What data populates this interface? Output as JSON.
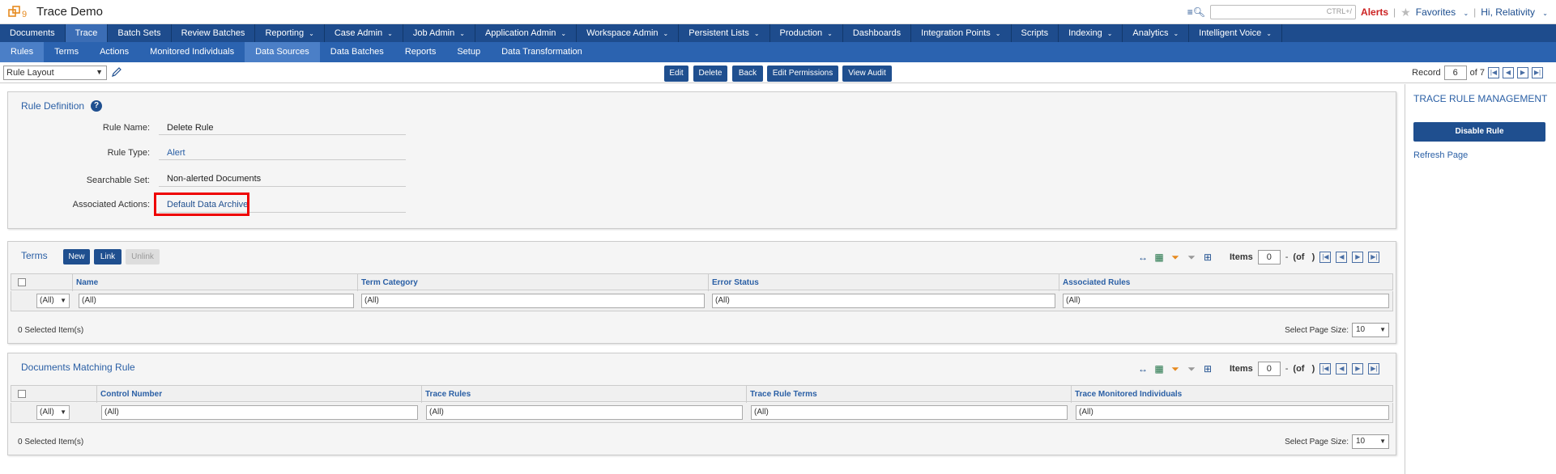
{
  "app": {
    "title": "Trace Demo"
  },
  "top": {
    "search_hint": "CTRL+/",
    "alerts": "Alerts",
    "favorites": "Favorites",
    "greeting": "Hi, Relativity"
  },
  "main_nav": [
    {
      "label": "Documents"
    },
    {
      "label": "Trace",
      "active": true
    },
    {
      "label": "Batch Sets"
    },
    {
      "label": "Review Batches"
    },
    {
      "label": "Reporting",
      "dropdown": true
    },
    {
      "label": "Case Admin",
      "dropdown": true
    },
    {
      "label": "Job Admin",
      "dropdown": true
    },
    {
      "label": "Application Admin",
      "dropdown": true
    },
    {
      "label": "Workspace Admin",
      "dropdown": true
    },
    {
      "label": "Persistent Lists",
      "dropdown": true
    },
    {
      "label": "Production",
      "dropdown": true
    },
    {
      "label": "Dashboards"
    },
    {
      "label": "Integration Points",
      "dropdown": true
    },
    {
      "label": "Scripts"
    },
    {
      "label": "Indexing",
      "dropdown": true
    },
    {
      "label": "Analytics",
      "dropdown": true
    },
    {
      "label": "Intelligent Voice",
      "dropdown": true
    }
  ],
  "sub_nav": [
    {
      "label": "Rules",
      "active": true
    },
    {
      "label": "Terms"
    },
    {
      "label": "Actions"
    },
    {
      "label": "Monitored Individuals"
    },
    {
      "label": "Data Sources",
      "active": true
    },
    {
      "label": "Data Batches"
    },
    {
      "label": "Reports"
    },
    {
      "label": "Setup"
    },
    {
      "label": "Data Transformation"
    }
  ],
  "toolbar": {
    "layout_value": "Rule Layout",
    "buttons": [
      "Edit",
      "Delete",
      "Back",
      "Edit Permissions",
      "View Audit"
    ],
    "record_label": "Record",
    "record_value": "6",
    "record_of": "of 7"
  },
  "rule_definition": {
    "title": "Rule Definition",
    "help": "?",
    "fields": [
      {
        "label": "Rule Name:",
        "value": "Delete Rule"
      },
      {
        "label": "Rule Type:",
        "value": "Alert"
      },
      {
        "label": "Searchable Set:",
        "value": "Non-alerted Documents"
      },
      {
        "label": "Associated Actions:",
        "value": "Default Data Archive"
      }
    ]
  },
  "sidebar": {
    "title": "Trace Rule Management",
    "button": "Disable Rule",
    "link": "Refresh Page"
  },
  "terms": {
    "title": "Terms",
    "buttons": {
      "new": "New",
      "link": "Link",
      "unlink": "Unlink"
    },
    "items_label": "Items",
    "items_value": "0",
    "dash": "-",
    "of_label": "(of",
    "of_close": ")",
    "filter_sel": "(All)",
    "columns": [
      "Name",
      "Term Category",
      "Error Status",
      "Associated Rules"
    ],
    "filter_value": "(All)",
    "selected": "0  Selected Item(s)",
    "page_size_label": "Select Page Size:",
    "page_size": "10"
  },
  "documents": {
    "title": "Documents Matching Rule",
    "items_label": "Items",
    "items_value": "0",
    "dash": "-",
    "of_label": "(of",
    "of_close": ")",
    "filter_sel": "(All)",
    "columns": [
      "Control Number",
      "Trace Rules",
      "Trace Rule Terms",
      "Trace Monitored Individuals"
    ],
    "filter_value": "(All)",
    "selected": "0  Selected Item(s)",
    "page_size_label": "Select Page Size:",
    "page_size": "10"
  }
}
